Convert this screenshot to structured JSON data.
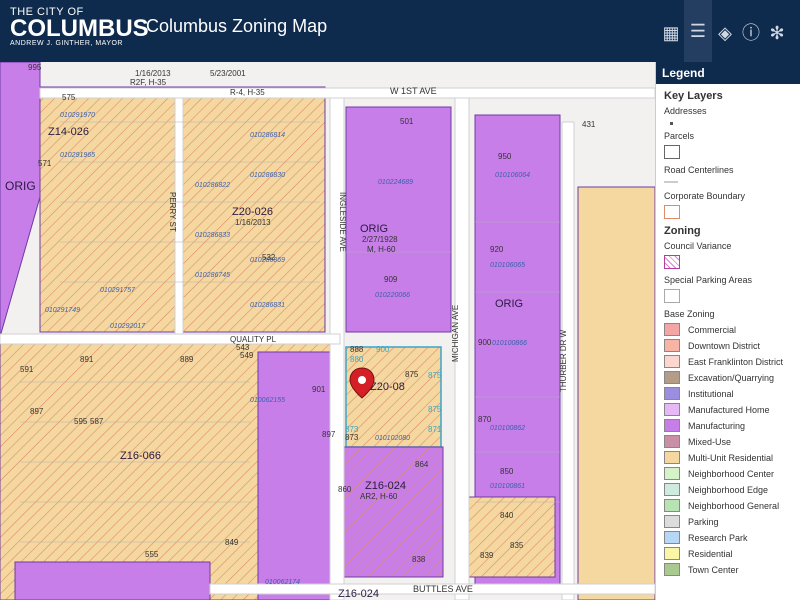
{
  "header": {
    "logo_line1": "THE CITY OF",
    "logo_line2": "COLUMBUS",
    "logo_line3": "ANDREW J. GINTHER, MAYOR",
    "title": "Columbus Zoning Map",
    "tools": [
      "basemap-grid-icon",
      "legend-list-icon",
      "layers-icon",
      "info-icon",
      "share-icon"
    ]
  },
  "map": {
    "streets": {
      "w1st": "W 1ST AVE",
      "perry": "PERRY ST",
      "ingleside": "INGLESIDE AVE",
      "quality": "QUALITY PL",
      "michigan": "MICHIGAN AVE",
      "thurber": "THURBER DR W",
      "buttles": "BUTTLES AVE"
    },
    "zone_labels": [
      "ORIG",
      "Z20-08",
      "Z16-024",
      "Z16-066",
      "Z16-024",
      "Z20-026",
      "Z14-026",
      "ORIG",
      "ORIG"
    ],
    "zone_texts": [
      "R2F, H-35",
      "1/16/2013",
      "5/23/2001",
      "2/27/1928",
      "M, H-60",
      "AR2, H-60",
      "1/16/2013",
      "R-4, H-35"
    ],
    "parcel_ids": [
      "010291970",
      "010291965",
      "010286822",
      "010286833",
      "010286745",
      "010286814",
      "010286830",
      "010286869",
      "010286831",
      "010224689",
      "010220066",
      "010106064",
      "010106065",
      "010100866",
      "010100862",
      "010100861",
      "010102080",
      "010062174",
      "010292017",
      "010291749",
      "010291757",
      "010062155"
    ],
    "addresses": [
      "995",
      "575",
      "571",
      "591",
      "501",
      "950",
      "920",
      "909",
      "888",
      "900",
      "870",
      "850",
      "840",
      "838",
      "835",
      "839",
      "860",
      "864",
      "875",
      "891",
      "889",
      "897",
      "901",
      "897",
      "587",
      "595",
      "549",
      "543",
      "555",
      "532",
      "431",
      "849",
      "873"
    ],
    "ward_labels": [
      "900",
      "880",
      "875",
      "873",
      "875",
      "871"
    ],
    "colors": {
      "residential_multi": "#f5d8a0",
      "manufacturing": "#c77ee8",
      "hatch": "#e08a6a",
      "parcel_line": "#b0b0b0",
      "street": "#ffffff",
      "zone_border": "#6e3aa6"
    }
  },
  "legend": {
    "title": "Legend",
    "key_layers_heading": "Key Layers",
    "key_layers": [
      {
        "label": "Addresses"
      },
      {
        "label": "Parcels"
      },
      {
        "label": "Road Centerlines"
      },
      {
        "label": "Corporate Boundary"
      }
    ],
    "zoning_heading": "Zoning",
    "zoning_layers": [
      {
        "label": "Council Variance"
      },
      {
        "label": "Special Parking Areas"
      }
    ],
    "base_zoning_heading": "Base Zoning",
    "base_zoning": [
      {
        "label": "Commercial",
        "color": "#f4a6a6"
      },
      {
        "label": "Downtown District",
        "color": "#f7b4a4"
      },
      {
        "label": "East Franklinton District",
        "color": "#fbd7d0"
      },
      {
        "label": "Excavation/Quarrying",
        "color": "#b39c88"
      },
      {
        "label": "Institutional",
        "color": "#9b8de0"
      },
      {
        "label": "Manufactured Home",
        "color": "#e6b8f5"
      },
      {
        "label": "Manufacturing",
        "color": "#c77ee8"
      },
      {
        "label": "Mixed-Use",
        "color": "#c98fa6"
      },
      {
        "label": "Multi-Unit Residential",
        "color": "#f5d8a0"
      },
      {
        "label": "Neighborhood Center",
        "color": "#d6f2c9"
      },
      {
        "label": "Neighborhood Edge",
        "color": "#cfeadf"
      },
      {
        "label": "Neighborhood General",
        "color": "#b8e3b3"
      },
      {
        "label": "Parking",
        "color": "#dcdcdc"
      },
      {
        "label": "Research Park",
        "color": "#b6d7f5"
      },
      {
        "label": "Residential",
        "color": "#fbf5a6"
      },
      {
        "label": "Town Center",
        "color": "#a9c98f"
      }
    ]
  }
}
